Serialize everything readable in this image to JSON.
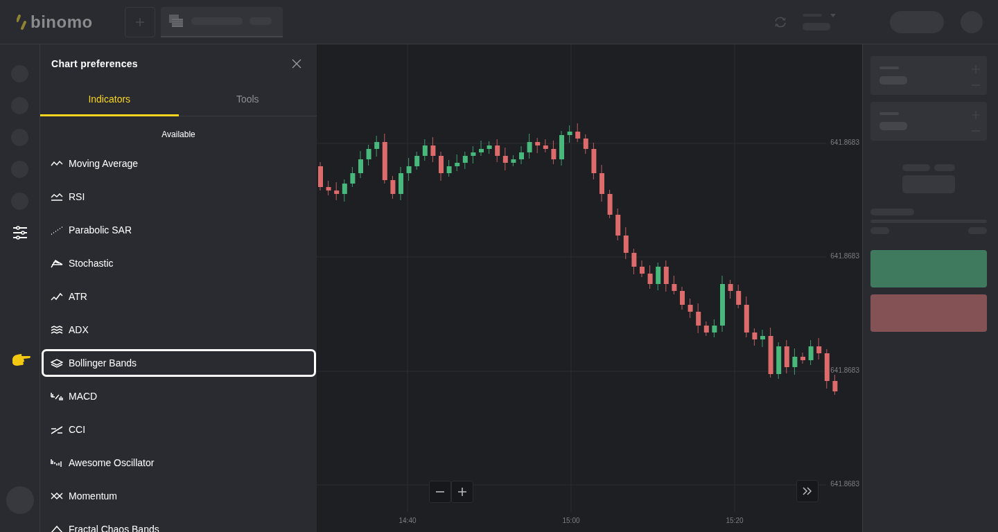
{
  "header": {
    "logo": "binomo"
  },
  "panel": {
    "title": "Chart preferences",
    "tabs": [
      {
        "label": "Indicators",
        "selected": true
      },
      {
        "label": "Tools",
        "selected": false
      }
    ],
    "section": "Available",
    "indicators": [
      {
        "label": "Moving Average",
        "kind": "moving-average",
        "highlighted": false
      },
      {
        "label": "RSI",
        "kind": "rsi",
        "highlighted": false
      },
      {
        "label": "Parabolic SAR",
        "kind": "sar",
        "highlighted": false
      },
      {
        "label": "Stochastic",
        "kind": "stochastic",
        "highlighted": false
      },
      {
        "label": "ATR",
        "kind": "atr",
        "highlighted": false
      },
      {
        "label": "ADX",
        "kind": "adx",
        "highlighted": false
      },
      {
        "label": "Bollinger Bands",
        "kind": "bollinger",
        "highlighted": true
      },
      {
        "label": "MACD",
        "kind": "macd",
        "highlighted": false
      },
      {
        "label": "CCI",
        "kind": "cci",
        "highlighted": false
      },
      {
        "label": "Awesome Oscillator",
        "kind": "oscillator",
        "highlighted": false
      },
      {
        "label": "Momentum",
        "kind": "momentum",
        "highlighted": false
      },
      {
        "label": "Fractal Chaos Bands",
        "kind": "fractal",
        "highlighted": false
      }
    ]
  },
  "chart": {
    "price_labels": [
      "641.8683",
      "641.8683",
      "641.8683",
      "641.8683"
    ],
    "time_labels": [
      "14:40",
      "15:00",
      "15:20"
    ]
  }
}
